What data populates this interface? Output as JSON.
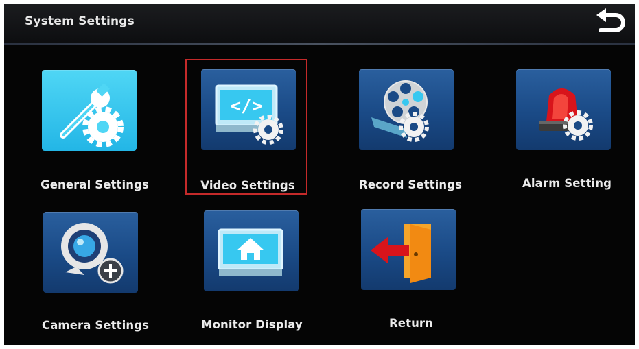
{
  "header": {
    "title": "System Settings",
    "back_icon": "back-arrow-icon"
  },
  "tiles": [
    {
      "label": "General Settings",
      "icon": "wrench-gear-icon"
    },
    {
      "label": "Video Settings",
      "icon": "monitor-code-gear-icon",
      "selected": true
    },
    {
      "label": "Record Settings",
      "icon": "film-reel-gear-icon"
    },
    {
      "label": "Alarm Setting",
      "icon": "siren-gear-icon"
    },
    {
      "label": "Camera Settings",
      "icon": "camera-add-icon"
    },
    {
      "label": "Monitor Display",
      "icon": "monitor-home-icon"
    },
    {
      "label": "Return",
      "icon": "exit-door-icon"
    }
  ],
  "colors": {
    "selection_border": "#c42a2a",
    "tile_blue": "#1a4a86",
    "accent_cyan": "#37c8f0"
  }
}
